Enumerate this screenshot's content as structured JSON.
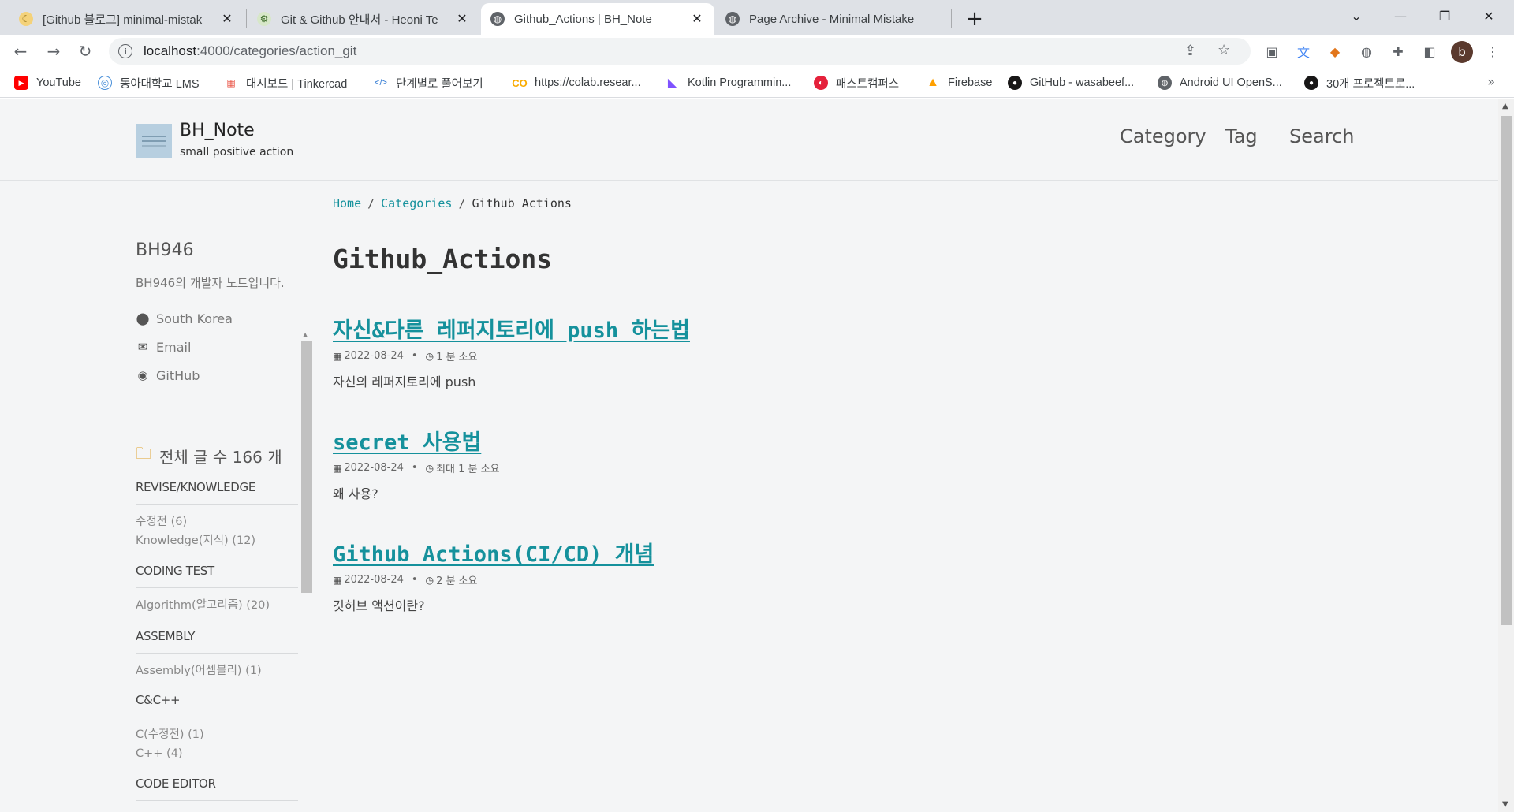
{
  "browser": {
    "tabs": [
      {
        "title": "[Github 블로그] minimal-mistak",
        "icon": "moon-icon",
        "active": false
      },
      {
        "title": "Git & Github 안내서 - Heoni Te",
        "icon": "octocat-icon",
        "active": false
      },
      {
        "title": "Github_Actions | BH_Note",
        "icon": "globe-icon",
        "active": true
      },
      {
        "title": "Page Archive - Minimal Mistake",
        "icon": "globe-icon",
        "active": false
      }
    ],
    "url_host": "localhost",
    "url_path": ":4000/categories/action_git",
    "profile_initial": "b",
    "bookmarks": [
      {
        "label": "YouTube",
        "icon": "youtube-icon",
        "color": "#ff0000"
      },
      {
        "label": "동아대학교 LMS",
        "icon": "lms-icon",
        "color": "#4a90d9"
      },
      {
        "label": "대시보드 | Tinkercad",
        "icon": "tinkercad-icon",
        "color": "#e84b3c"
      },
      {
        "label": "단계별로 풀어보기",
        "icon": "code-icon",
        "color": "#2a76d2"
      },
      {
        "label": "https://colab.resear...",
        "icon": "colab-icon",
        "color": "#f9ab00"
      },
      {
        "label": "Kotlin Programmin...",
        "icon": "kotlin-icon",
        "color": "#7f52ff"
      },
      {
        "label": "패스트캠퍼스",
        "icon": "fastcampus-icon",
        "color": "#e5213b"
      },
      {
        "label": "Firebase",
        "icon": "firebase-icon",
        "color": "#ffa000"
      },
      {
        "label": "GitHub - wasabeef...",
        "icon": "github-icon",
        "color": "#181717"
      },
      {
        "label": "Android UI OpenS...",
        "icon": "globe-icon",
        "color": "#5f6368"
      },
      {
        "label": "30개 프로젝트로...",
        "icon": "github-icon",
        "color": "#181717"
      }
    ]
  },
  "site": {
    "title": "BH_Note",
    "subtitle": "small positive action",
    "nav": [
      "Category",
      "Tag",
      "Search"
    ]
  },
  "breadcrumbs": {
    "home": "Home",
    "categories": "Categories",
    "current": "Github_Actions"
  },
  "author": {
    "name": "BH946",
    "bio": "BH946의 개발자 노트입니다.",
    "links": [
      {
        "label": "South Korea",
        "icon": "map-marker-icon"
      },
      {
        "label": "Email",
        "icon": "envelope-icon"
      },
      {
        "label": "GitHub",
        "icon": "github-icon"
      }
    ]
  },
  "category_nav": {
    "total_label": "전체 글 수 166 개",
    "groups": [
      {
        "head": "REVISE/KNOWLEDGE",
        "items": [
          "수정전 (6)",
          "Knowledge(지식) (12)"
        ]
      },
      {
        "head": "CODING TEST",
        "items": [
          "Algorithm(알고리즘) (20)"
        ]
      },
      {
        "head": "ASSEMBLY",
        "items": [
          "Assembly(어셈블리) (1)"
        ]
      },
      {
        "head": "C&C++",
        "items": [
          "C(수정전) (1)",
          "C++ (4)"
        ]
      },
      {
        "head": "CODE EDITOR",
        "items": []
      }
    ]
  },
  "main": {
    "page_title": "Github_Actions",
    "posts": [
      {
        "title": "자신&다른 레퍼지토리에 push 하는법",
        "date": "2022-08-24",
        "read_time": "1 분 소요",
        "excerpt": "자신의 레퍼지토리에 push"
      },
      {
        "title": "secret 사용법",
        "date": "2022-08-24",
        "read_time": "최대 1 분 소요",
        "excerpt": "왜 사용?"
      },
      {
        "title": "Github Actions(CI/CD) 개념",
        "date": "2022-08-24",
        "read_time": "2 분 소요",
        "excerpt": "깃허브 액션이란?"
      }
    ]
  },
  "colors": {
    "link": "#15919c",
    "page_bg": "#f4f5f6",
    "tabstrip_bg": "#dee1e6"
  }
}
